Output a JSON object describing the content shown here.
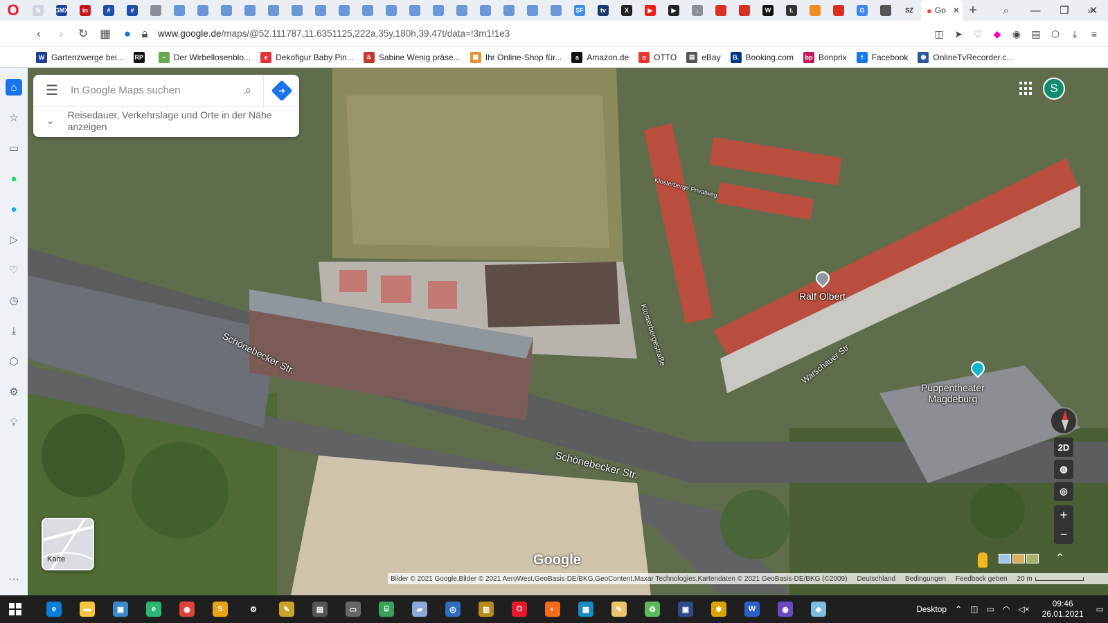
{
  "browser": {
    "tabs": [
      {
        "icon": "news-icon",
        "color": "#cfd5de",
        "text": "N"
      },
      {
        "icon": "gmx-icon",
        "color": "#1c449b",
        "text": "GMX"
      },
      {
        "icon": "linkedin-icon",
        "color": "#c4161c",
        "text": "in"
      },
      {
        "icon": "grid-icon",
        "color": "#1d4ea8",
        "text": "#"
      },
      {
        "icon": "grid-icon",
        "color": "#1d4ea8",
        "text": "#"
      },
      {
        "icon": "document-icon",
        "color": "#8a8f98",
        "text": ""
      },
      {
        "icon": "blue-tab-icon",
        "color": "#6b97d6",
        "text": ""
      },
      {
        "icon": "blue-tab-icon",
        "color": "#6b97d6",
        "text": ""
      },
      {
        "icon": "blue-tab-icon",
        "color": "#6b97d6",
        "text": ""
      },
      {
        "icon": "blue-tab-icon",
        "color": "#6b97d6",
        "text": ""
      },
      {
        "icon": "blue-tab-icon",
        "color": "#6b97d6",
        "text": ""
      },
      {
        "icon": "blue-tab-icon",
        "color": "#6b97d6",
        "text": ""
      },
      {
        "icon": "blue-tab-icon",
        "color": "#6b97d6",
        "text": ""
      },
      {
        "icon": "blue-tab-icon",
        "color": "#6b97d6",
        "text": ""
      },
      {
        "icon": "blue-tab-icon",
        "color": "#6b97d6",
        "text": ""
      },
      {
        "icon": "blue-tab-icon",
        "color": "#6b97d6",
        "text": ""
      },
      {
        "icon": "blue-tab-icon",
        "color": "#6b97d6",
        "text": ""
      },
      {
        "icon": "blue-tab-icon",
        "color": "#6b97d6",
        "text": ""
      },
      {
        "icon": "blue-tab-icon",
        "color": "#6b97d6",
        "text": ""
      },
      {
        "icon": "blue-tab-icon",
        "color": "#6b97d6",
        "text": ""
      },
      {
        "icon": "blue-tab-icon",
        "color": "#6b97d6",
        "text": ""
      },
      {
        "icon": "blue-tab-icon",
        "color": "#6b97d6",
        "text": ""
      },
      {
        "icon": "blue-tab-icon",
        "color": "#6b97d6",
        "text": ""
      },
      {
        "icon": "sf-icon",
        "color": "#3a8ee6",
        "text": "SF"
      },
      {
        "icon": "tv-icon",
        "color": "#1a3a6e",
        "text": "tv"
      },
      {
        "icon": "x-icon",
        "color": "#222222",
        "text": "X"
      },
      {
        "icon": "youtube-icon",
        "color": "#e62117",
        "text": "▶"
      },
      {
        "icon": "play-icon",
        "color": "#222222",
        "text": "▶"
      },
      {
        "icon": "download-icon",
        "color": "#8a8f98",
        "text": "↓"
      },
      {
        "icon": "red-tab-icon",
        "color": "#d93025",
        "text": ""
      },
      {
        "icon": "red-tab-icon",
        "color": "#d93025",
        "text": ""
      },
      {
        "icon": "w-icon",
        "color": "#111111",
        "text": "W"
      },
      {
        "icon": "t-icon",
        "color": "#333333",
        "text": "t."
      },
      {
        "icon": "orange-tab-icon",
        "color": "#f28b20",
        "text": ""
      },
      {
        "icon": "red-tab-icon",
        "color": "#d93025",
        "text": ""
      },
      {
        "icon": "google-icon",
        "color": "#4285f4",
        "text": "G"
      },
      {
        "icon": "animal-icon",
        "color": "#555555",
        "text": ""
      },
      {
        "icon": "sz-icon",
        "color": "#ebeef3",
        "text": "SZ"
      }
    ],
    "active_tab": {
      "label": "Go",
      "icon": "google-maps-icon"
    },
    "url_host": "www.google.de",
    "url_path": "/maps/@52.111787,11.6351125,222a,35y,180h,39.47t/data=!3m1!1e3",
    "bookmarks": [
      {
        "label": "Gartenzwerge bei...",
        "icon": "w-icon",
        "color": "#1a3d9c",
        "glyph": "W"
      },
      {
        "label": "",
        "icon": "rp-icon",
        "color": "#111111",
        "glyph": "RP"
      },
      {
        "label": "Der Wirbellosenblo...",
        "icon": "leaf-icon",
        "color": "#6aa84f",
        "glyph": "~"
      },
      {
        "label": "Dekofigur Baby Pin...",
        "icon": "ebay-mini-icon",
        "color": "#e53238",
        "glyph": "e"
      },
      {
        "label": "Sabine Wenig präse...",
        "icon": "fire-icon",
        "color": "#c0392b",
        "glyph": "♨"
      },
      {
        "label": "Ihr Online-Shop für...",
        "icon": "shop-icon",
        "color": "#e69138",
        "glyph": "▦"
      },
      {
        "label": "Amazon.de",
        "icon": "amazon-icon",
        "color": "#111111",
        "glyph": "a"
      },
      {
        "label": "OTTO",
        "icon": "otto-icon",
        "color": "#e53935",
        "glyph": "o"
      },
      {
        "label": "eBay",
        "icon": "document-icon",
        "color": "#555555",
        "glyph": "▤"
      },
      {
        "label": "Booking.com",
        "icon": "booking-icon",
        "color": "#003580",
        "glyph": "B."
      },
      {
        "label": "Bonprix",
        "icon": "bonprix-icon",
        "color": "#c2185b",
        "glyph": "bp"
      },
      {
        "label": "Facebook",
        "icon": "facebook-icon",
        "color": "#1877f2",
        "glyph": "f"
      },
      {
        "label": "OnlineTvRecorder.c...",
        "icon": "otr-icon",
        "color": "#2b5797",
        "glyph": "◉"
      }
    ]
  },
  "maps": {
    "search_placeholder": "In Google Maps suchen",
    "suggestion": "Reisedauer, Verkehrslage und Orte in der Nähe anzeigen",
    "avatar_initial": "S",
    "streets": [
      "Schönebecker Str.",
      "Schönebecker Str.",
      "Klosterbergestraße",
      "Warschauer Str.",
      "Klosterberge Privatweg"
    ],
    "pois": [
      {
        "name": "Ralf Olbert",
        "color": "#8c98a3"
      },
      {
        "name": "Puppentheater\nMagdeburg",
        "color": "#12b5cb"
      }
    ],
    "tilt_button": "2D",
    "layer_label": "Karte",
    "logo": "Google",
    "attribution": [
      "Bilder © 2021 Google,Bilder © 2021 AeroWest,GeoBasis-DE/BKG,GeoContent,Maxar Technologies,Kartendaten © 2021 GeoBasis-DE/BKG (©2009)",
      "Deutschland",
      "Bedingungen",
      "Feedback geben"
    ],
    "scale_text": "20 m"
  },
  "taskbar": {
    "apps": [
      {
        "icon": "edge-icon",
        "color": "#0b7fd6",
        "glyph": "e"
      },
      {
        "icon": "explorer-icon",
        "color": "#f6c343",
        "glyph": "▬"
      },
      {
        "icon": "monitor-icon",
        "color": "#3a87c9",
        "glyph": "▣"
      },
      {
        "icon": "e-app-icon",
        "color": "#2bb673",
        "glyph": "e"
      },
      {
        "icon": "chrome-icon",
        "color": "#db4437",
        "glyph": "◉"
      },
      {
        "icon": "s-app-icon",
        "color": "#e8a317",
        "glyph": "S"
      },
      {
        "icon": "settings-icon",
        "color": "#1f1f1f",
        "glyph": "⚙"
      },
      {
        "icon": "tools-icon",
        "color": "#c9a227",
        "glyph": "✎"
      },
      {
        "icon": "photo-icon",
        "color": "#555555",
        "glyph": "▤"
      },
      {
        "icon": "window-icon",
        "color": "#666666",
        "glyph": "▭"
      },
      {
        "icon": "network-icon",
        "color": "#3aa05a",
        "glyph": "⌸"
      },
      {
        "icon": "cert-icon",
        "color": "#8aa8d8",
        "glyph": "▰"
      },
      {
        "icon": "disk-icon",
        "color": "#2f6bbf",
        "glyph": "◎"
      },
      {
        "icon": "archive-icon",
        "color": "#b88a1c",
        "glyph": "▥"
      },
      {
        "icon": "opera-icon",
        "color": "#e8192c",
        "glyph": "O"
      },
      {
        "icon": "firefox-icon",
        "color": "#f26c1a",
        "glyph": "◐"
      },
      {
        "icon": "calendar-icon",
        "color": "#1b8bbf",
        "glyph": "▦"
      },
      {
        "icon": "notes-icon",
        "color": "#e9c46a",
        "glyph": "✎"
      },
      {
        "icon": "cleaner-icon",
        "color": "#5cb85c",
        "glyph": "♻"
      },
      {
        "icon": "monitor-app-icon",
        "color": "#2e4a8b",
        "glyph": "▣"
      },
      {
        "icon": "bug-icon",
        "color": "#d9a400",
        "glyph": "✱"
      },
      {
        "icon": "shield-icon",
        "color": "#2962c4",
        "glyph": "W"
      },
      {
        "icon": "privacy-icon",
        "color": "#6b46c1",
        "glyph": "◉"
      },
      {
        "icon": "store-icon",
        "color": "#7dbbe0",
        "glyph": "◆"
      }
    ],
    "desktop_label": "Desktop",
    "time": "09:46",
    "date": "26.01.2021"
  }
}
